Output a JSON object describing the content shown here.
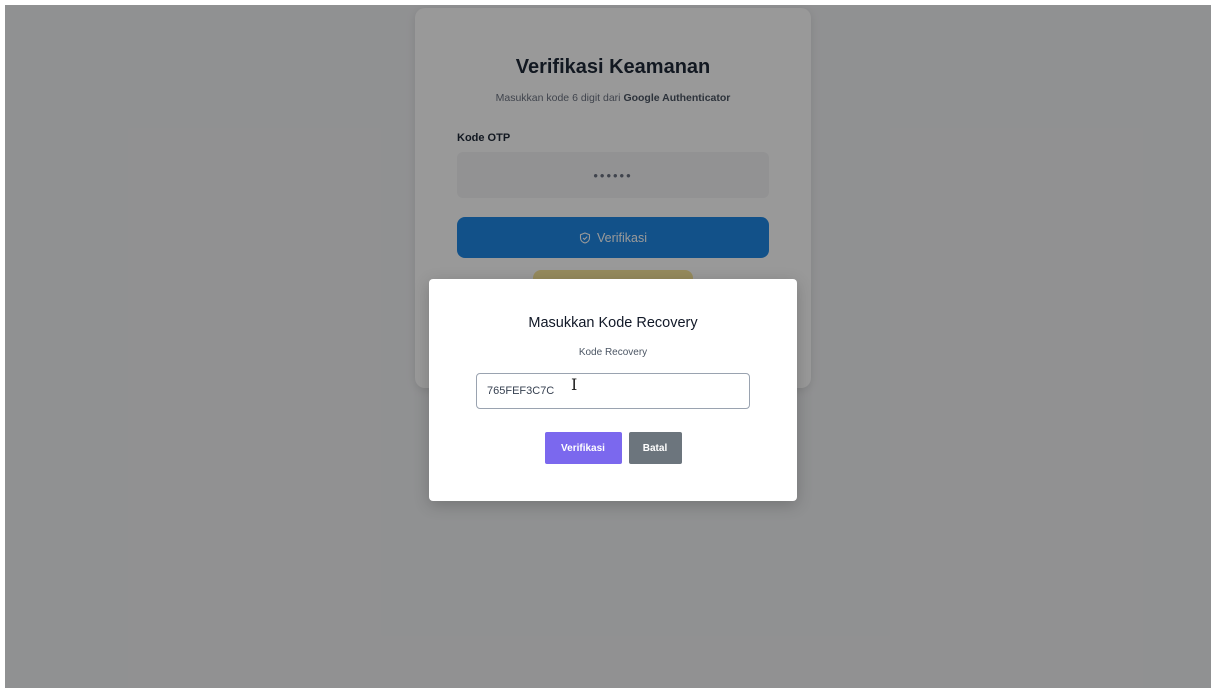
{
  "card": {
    "title": "Verifikasi Keamanan",
    "subtitle_prefix": "Masukkan kode 6 digit dari ",
    "subtitle_app": "Google Authenticator",
    "otp_label": "Kode OTP",
    "otp_placeholder": "••••••",
    "verify_label": "Verifikasi",
    "verify_icon": "shield-check-icon"
  },
  "modal": {
    "title": "Masukkan Kode Recovery",
    "field_label": "Kode Recovery",
    "input_value": "765FEF3C7C",
    "cursor_icon": "text-cursor-icon",
    "verify_label": "Verifikasi",
    "cancel_label": "Batal"
  },
  "colors": {
    "primary_blue": "#1e88e5",
    "modal_verify": "#7b68ee",
    "modal_cancel": "#6c757d",
    "overlay": "rgba(0,0,0,0.40)"
  }
}
